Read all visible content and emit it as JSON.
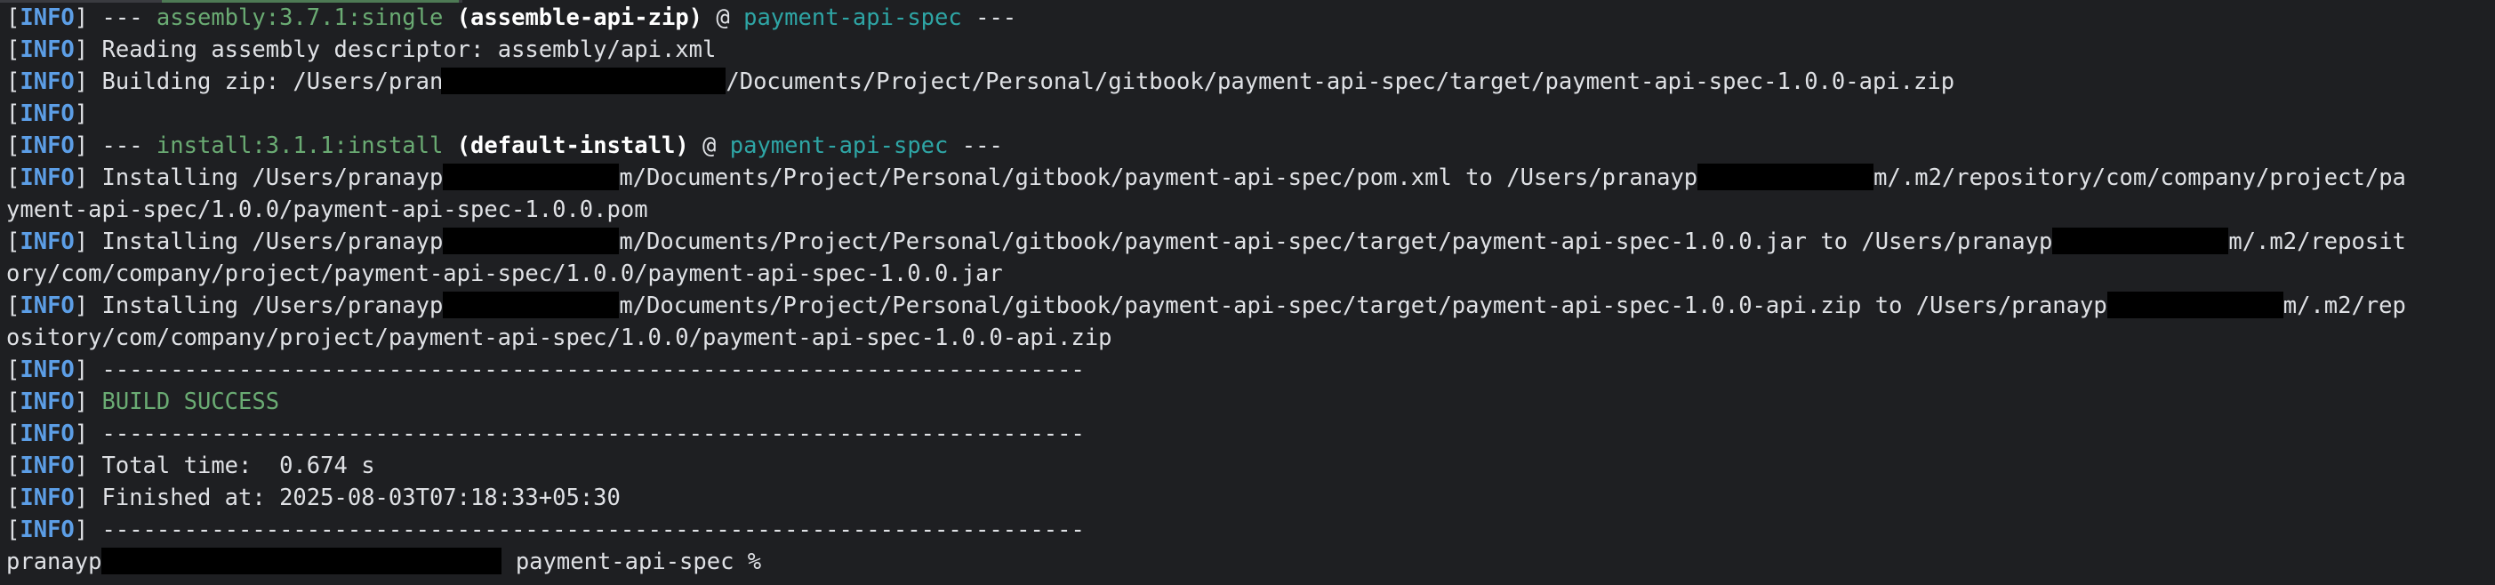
{
  "info_label": "INFO",
  "lines": [
    {
      "t": "mojo",
      "plugin": "assembly:3.7.1:single",
      "goal": "(assemble-api-zip)",
      "at": "@",
      "project": "payment-api-spec",
      "sep": "---"
    },
    {
      "t": "plain",
      "text": "Reading assembly descriptor: assembly/api.xml"
    },
    {
      "t": "redacted",
      "parts": [
        "Building zip: /Users/pranayp",
        "/Documents/Project/Personal/gitbook/payment-api-spec/target/payment-api-spec-1.0.0-api.zip"
      ],
      "sizes": [
        "zip"
      ]
    },
    {
      "t": "empty"
    },
    {
      "t": "mojo",
      "plugin": "install:3.1.1:install",
      "goal": "(default-install)",
      "at": "@",
      "project": "payment-api-spec",
      "sep": "---"
    },
    {
      "t": "redacted",
      "parts": [
        "Installing /Users/pranayp",
        "m/Documents/Project/Personal/gitbook/payment-api-spec/pom.xml to /Users/pranayp",
        "m/.m2/repository/com/company/project/pa"
      ],
      "sizes": [
        "short",
        "short"
      ]
    },
    {
      "t": "cont",
      "text": "yment-api-spec/1.0.0/payment-api-spec-1.0.0.pom"
    },
    {
      "t": "redacted",
      "parts": [
        "Installing /Users/pranayp",
        "m/Documents/Project/Personal/gitbook/payment-api-spec/target/payment-api-spec-1.0.0.jar to /Users/pranayp",
        "m/.m2/reposit"
      ],
      "sizes": [
        "short",
        "short"
      ]
    },
    {
      "t": "cont",
      "text": "ory/com/company/project/payment-api-spec/1.0.0/payment-api-spec-1.0.0.jar"
    },
    {
      "t": "redacted",
      "parts": [
        "Installing /Users/pranayp",
        "m/Documents/Project/Personal/gitbook/payment-api-spec/target/payment-api-spec-1.0.0-api.zip to /Users/pranayp",
        "m/.m2/rep"
      ],
      "sizes": [
        "short",
        "short"
      ]
    },
    {
      "t": "cont",
      "text": "ository/com/company/project/payment-api-spec/1.0.0/payment-api-spec-1.0.0-api.zip"
    },
    {
      "t": "plain",
      "text": "------------------------------------------------------------------------"
    },
    {
      "t": "success",
      "text": "BUILD SUCCESS"
    },
    {
      "t": "plain",
      "text": "------------------------------------------------------------------------"
    },
    {
      "t": "plain",
      "text": "Total time:  0.674 s"
    },
    {
      "t": "plain",
      "text": "Finished at: 2025-08-03T07:18:33+05:30"
    },
    {
      "t": "plain",
      "text": "------------------------------------------------------------------------"
    },
    {
      "t": "prompt",
      "user": "pranayp",
      "cwd": " payment-api-spec %"
    }
  ],
  "colors": {
    "background": "#1e1f22",
    "foreground": "#dfe1e5",
    "info_label": "#5c9ee6",
    "plugin": "#6aab73",
    "project": "#2ea5a5",
    "success": "#6aab73",
    "redaction": "#000000"
  }
}
